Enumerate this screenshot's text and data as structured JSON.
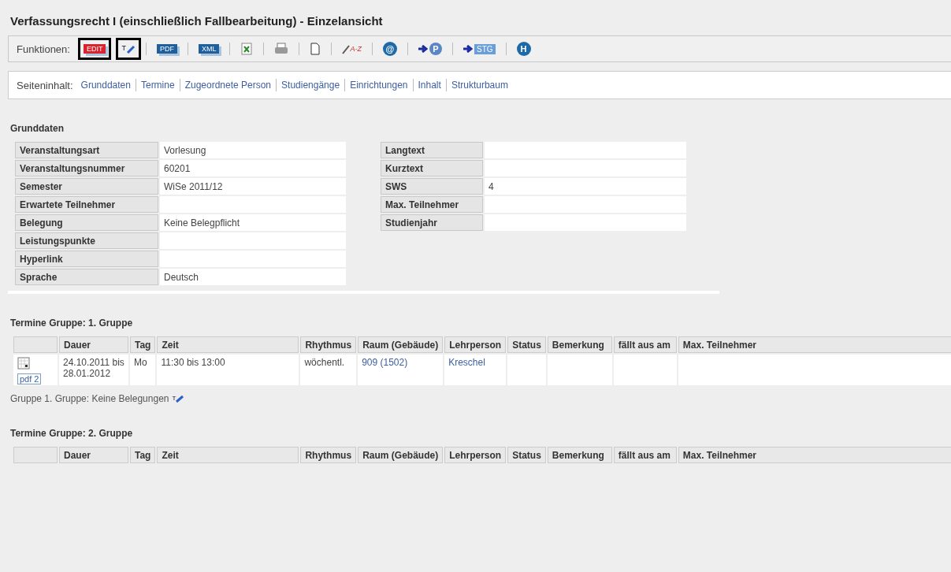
{
  "title": "Verfassungsrecht I (einschließlich Fallbearbeitung) - Einzelansicht",
  "toolbar": {
    "label": "Funktionen:",
    "items": [
      {
        "kind": "badge",
        "label": "EDIT",
        "color": "#d9232e",
        "highlighted": true
      },
      {
        "kind": "pen",
        "label": "T",
        "highlighted": true
      },
      {
        "kind": "badge",
        "label": "PDF",
        "color": "#1f5f9c",
        "highlighted": false
      },
      {
        "kind": "badge",
        "label": "XML",
        "color": "#1f5f9c",
        "highlighted": false
      },
      {
        "kind": "excel",
        "highlighted": false
      },
      {
        "kind": "printer",
        "highlighted": false
      },
      {
        "kind": "page",
        "highlighted": false
      },
      {
        "kind": "az",
        "label": "A-Z",
        "highlighted": false
      },
      {
        "kind": "circle",
        "label": "@",
        "highlighted": false
      },
      {
        "kind": "arrow-circle",
        "label": "P",
        "highlighted": false
      },
      {
        "kind": "arrow-badge",
        "label": "STG",
        "highlighted": false
      },
      {
        "kind": "circle",
        "label": "H",
        "highlighted": false
      }
    ]
  },
  "page_nav": {
    "label": "Seiteninhalt:",
    "links": [
      "Grunddaten",
      "Termine",
      "Zugeordnete Person",
      "Studiengänge",
      "Einrichtungen",
      "Inhalt",
      "Strukturbaum"
    ]
  },
  "grunddaten": {
    "heading": "Grunddaten",
    "left": [
      {
        "label": "Veranstaltungsart",
        "value": "Vorlesung"
      },
      {
        "label": "Veranstaltungsnummer",
        "value": "60201"
      },
      {
        "label": "Semester",
        "value": "WiSe 2011/12"
      },
      {
        "label": "Erwartete Teilnehmer"
      },
      {
        "label": "Belegung",
        "value": "Keine Belegpflicht"
      },
      {
        "label": "Leistungspunkte"
      },
      {
        "label": "Hyperlink"
      },
      {
        "label": "Sprache",
        "value": "Deutsch"
      }
    ],
    "right": [
      {
        "label": "Langtext"
      },
      {
        "label": "Kurztext"
      },
      {
        "label": "SWS",
        "value": "4"
      },
      {
        "label": "Max. Teilnehmer"
      },
      {
        "label": "Studienjahr"
      }
    ]
  },
  "groups": [
    {
      "heading": "Termine Gruppe: 1. Gruppe",
      "columns": [
        "Dauer",
        "Tag",
        "Zeit",
        "Rhythmus",
        "Raum (Gebäude)",
        "Lehrperson",
        "Status",
        "Bemerkung",
        "fällt aus am",
        "Max. Teilnehmer"
      ],
      "rows": [
        {
          "pdf": "pdf 2",
          "cells": [
            {
              "kind": "text",
              "text": "24.10.2011 bis 28.01.2012"
            },
            {
              "kind": "text",
              "text": "Mo"
            },
            {
              "kind": "text",
              "text": "11:30 bis 13:00"
            },
            {
              "kind": "text",
              "text": "wöchentl."
            },
            {
              "kind": "link",
              "text": "909 (1502)"
            },
            {
              "kind": "link",
              "text": "Kreschel"
            }
          ]
        }
      ],
      "note": "Gruppe 1. Gruppe: Keine Belegungen",
      "note_icon": "T"
    },
    {
      "heading": "Termine Gruppe: 2. Gruppe",
      "columns": [
        "Dauer",
        "Tag",
        "Zeit",
        "Rhythmus",
        "Raum (Gebäude)",
        "Lehrperson",
        "Status",
        "Bemerkung",
        "fällt aus am",
        "Max. Teilnehmer"
      ]
    }
  ]
}
